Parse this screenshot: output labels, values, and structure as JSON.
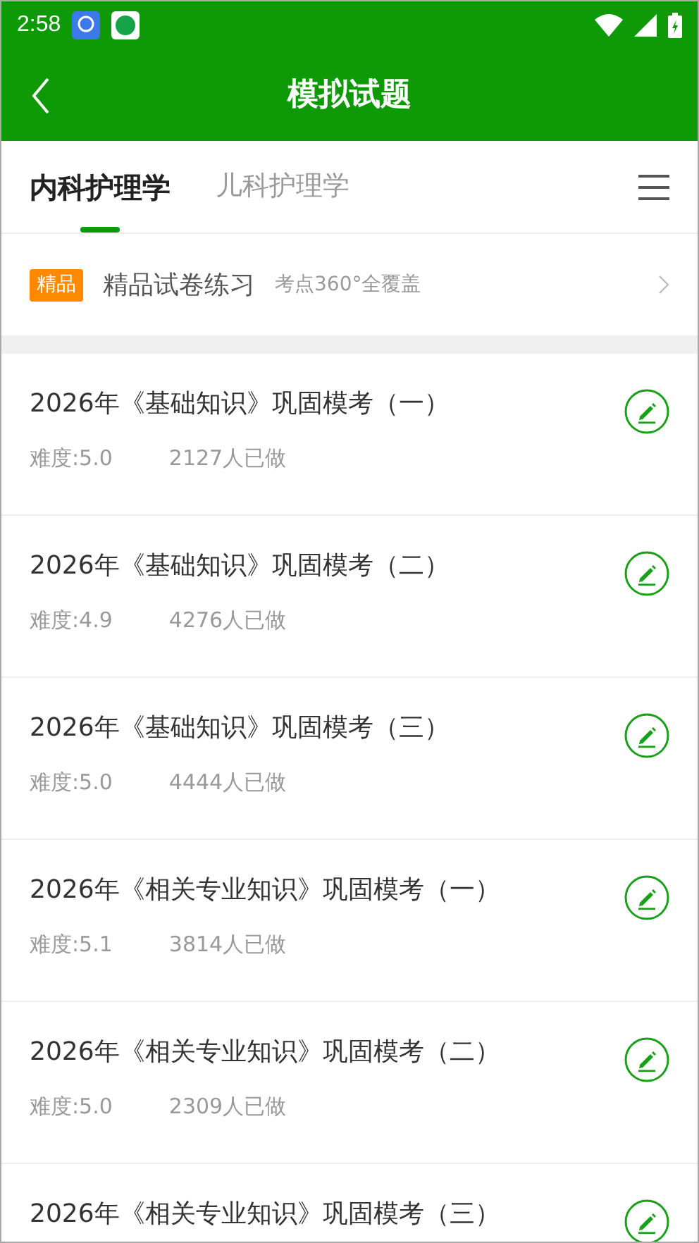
{
  "status_bar": {
    "time": "2:58"
  },
  "header": {
    "title": "模拟试题"
  },
  "tabs": [
    {
      "label": "内科护理学",
      "selected": true
    },
    {
      "label": "儿科护理学",
      "selected": false
    }
  ],
  "promo": {
    "badge": "精品",
    "title": "精品试卷练习",
    "subtitle": "考点360°全覆盖"
  },
  "exams": [
    {
      "title": "2026年《基础知识》巩固模考（一）",
      "difficulty": "难度:5.0",
      "count": "2127人已做"
    },
    {
      "title": "2026年《基础知识》巩固模考（二）",
      "difficulty": "难度:4.9",
      "count": "4276人已做"
    },
    {
      "title": "2026年《基础知识》巩固模考（三）",
      "difficulty": "难度:5.0",
      "count": "4444人已做"
    },
    {
      "title": "2026年《相关专业知识》巩固模考（一）",
      "difficulty": "难度:5.1",
      "count": "3814人已做"
    },
    {
      "title": "2026年《相关专业知识》巩固模考（二）",
      "difficulty": "难度:5.0",
      "count": "2309人已做"
    },
    {
      "title": "2026年《相关专业知识》巩固模考（三）"
    }
  ]
}
